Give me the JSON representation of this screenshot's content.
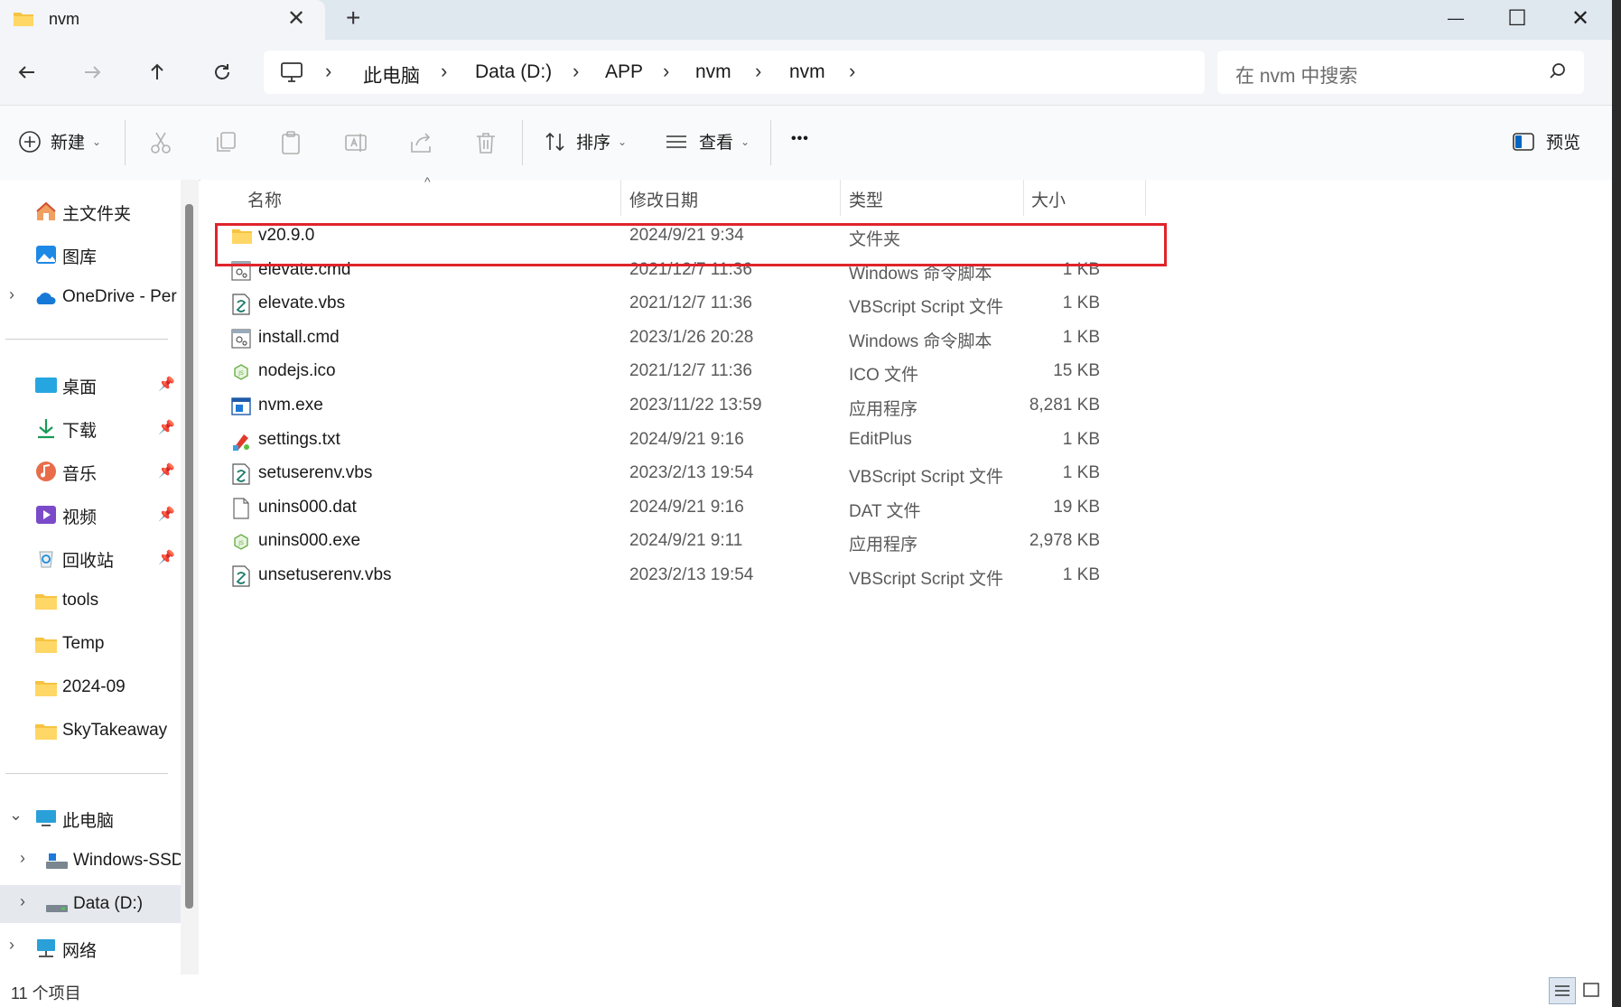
{
  "window": {
    "tab_title": "nvm",
    "tab_close": "✕",
    "new_tab": "+",
    "minimize": "—",
    "maximize": "☐",
    "close": "✕"
  },
  "nav": {
    "breadcrumbs": [
      "此电脑",
      "Data (D:)",
      "APP",
      "nvm",
      "nvm"
    ],
    "search_placeholder": "在 nvm 中搜索"
  },
  "toolbar": {
    "new_label": "新建",
    "sort_label": "排序",
    "view_label": "查看",
    "more_label": "•••",
    "preview_label": "预览"
  },
  "sidebar": {
    "home": "主文件夹",
    "gallery": "图库",
    "onedrive": "OneDrive - Per",
    "desktop": "桌面",
    "downloads": "下载",
    "music": "音乐",
    "videos": "视频",
    "recycle": "回收站",
    "tools": "tools",
    "temp": "Temp",
    "folder_2024": "2024-09",
    "skytakeaway": "SkyTakeaway",
    "this_pc": "此电脑",
    "windows_ssd": "Windows-SSD",
    "data_d": "Data (D:)",
    "network": "网络"
  },
  "columns": {
    "name": "名称",
    "date": "修改日期",
    "type": "类型",
    "size": "大小"
  },
  "files": [
    {
      "name": "v20.9.0",
      "date": "2024/9/21 9:34",
      "type": "文件夹",
      "size": "",
      "icon": "folder-icon"
    },
    {
      "name": "elevate.cmd",
      "date": "2021/12/7 11:36",
      "type": "Windows 命令脚本",
      "size": "1 KB",
      "icon": "cmd-icon"
    },
    {
      "name": "elevate.vbs",
      "date": "2021/12/7 11:36",
      "type": "VBScript Script 文件",
      "size": "1 KB",
      "icon": "vbs-icon"
    },
    {
      "name": "install.cmd",
      "date": "2023/1/26 20:28",
      "type": "Windows 命令脚本",
      "size": "1 KB",
      "icon": "cmd-icon"
    },
    {
      "name": "nodejs.ico",
      "date": "2021/12/7 11:36",
      "type": "ICO 文件",
      "size": "15 KB",
      "icon": "nodejs-icon"
    },
    {
      "name": "nvm.exe",
      "date": "2023/11/22 13:59",
      "type": "应用程序",
      "size": "8,281 KB",
      "icon": "exe-icon"
    },
    {
      "name": "settings.txt",
      "date": "2024/9/21 9:16",
      "type": "EditPlus",
      "size": "1 KB",
      "icon": "editplus-icon"
    },
    {
      "name": "setuserenv.vbs",
      "date": "2023/2/13 19:54",
      "type": "VBScript Script 文件",
      "size": "1 KB",
      "icon": "vbs-icon"
    },
    {
      "name": "unins000.dat",
      "date": "2024/9/21 9:16",
      "type": "DAT 文件",
      "size": "19 KB",
      "icon": "file-icon"
    },
    {
      "name": "unins000.exe",
      "date": "2024/9/21 9:11",
      "type": "应用程序",
      "size": "2,978 KB",
      "icon": "nodejs-icon"
    },
    {
      "name": "unsetuserenv.vbs",
      "date": "2023/2/13 19:54",
      "type": "VBScript Script 文件",
      "size": "1 KB",
      "icon": "vbs-icon"
    }
  ],
  "status": {
    "item_count": "11 个项目"
  },
  "colors": {
    "highlight": "#e0242a",
    "folder": "#f6c342",
    "accent": "#0067c0"
  }
}
